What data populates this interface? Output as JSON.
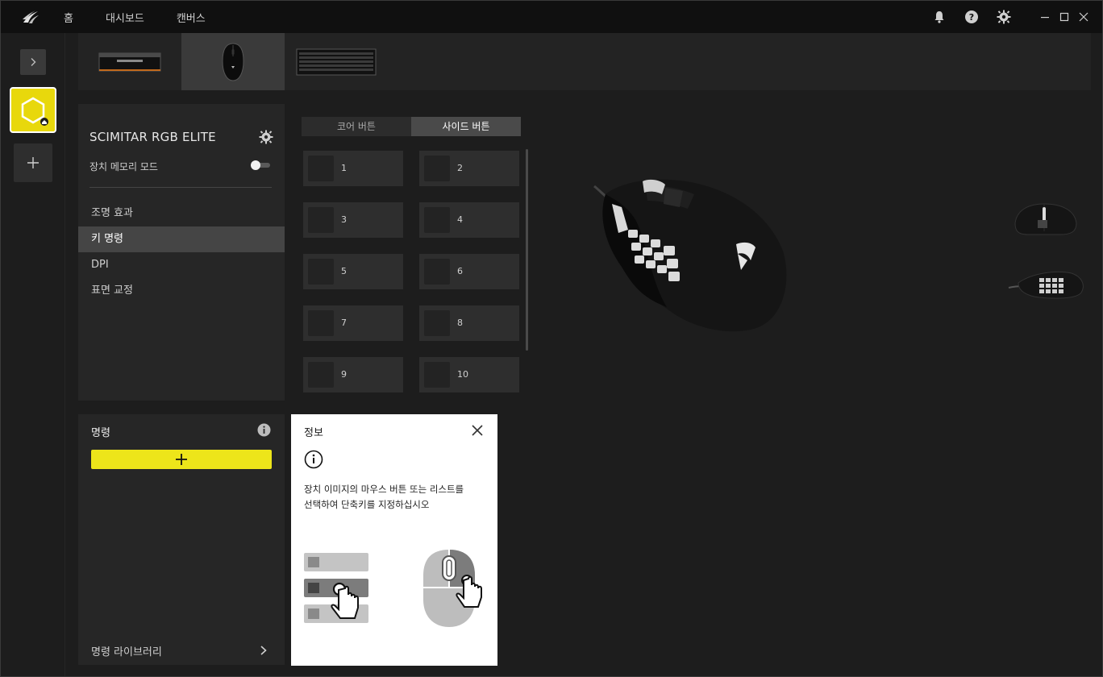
{
  "titlebar": {
    "nav": [
      "홈",
      "대시보드",
      "캔버스"
    ],
    "icons": [
      "notification-bell-icon",
      "help-icon",
      "settings-gear-icon"
    ],
    "window_controls": [
      "minimize",
      "maximize",
      "close"
    ]
  },
  "device_tabs": [
    {
      "name": "memory-module",
      "active": false
    },
    {
      "name": "mouse",
      "active": true
    },
    {
      "name": "keyboard",
      "active": false
    }
  ],
  "device": {
    "name": "SCIMITAR RGB ELITE",
    "memory_mode_label": "장치 메모리 모드",
    "memory_mode_on": false
  },
  "menu": [
    {
      "label": "조명 효과",
      "active": false
    },
    {
      "label": "키 명령",
      "active": true
    },
    {
      "label": "DPI",
      "active": false
    },
    {
      "label": "표면 교정",
      "active": false
    }
  ],
  "button_tabs": [
    {
      "label": "코어 버튼",
      "active": false
    },
    {
      "label": "사이드 버튼",
      "active": true
    }
  ],
  "side_buttons": [
    "1",
    "2",
    "3",
    "4",
    "5",
    "6",
    "7",
    "8",
    "9",
    "10"
  ],
  "commands": {
    "title": "명령",
    "add_label": "+",
    "library_label": "명령 라이브러리"
  },
  "info_popup": {
    "title": "정보",
    "text_line1": "장치 이미지의 마우스 버튼 또는 리스트를",
    "text_line2": "선택하여 단축키를 지정하십시오"
  },
  "colors": {
    "accent_yellow": "#ede51a",
    "profile_yellow": "#e8d80c",
    "background": "#1d1d1d",
    "panel": "#262626"
  }
}
